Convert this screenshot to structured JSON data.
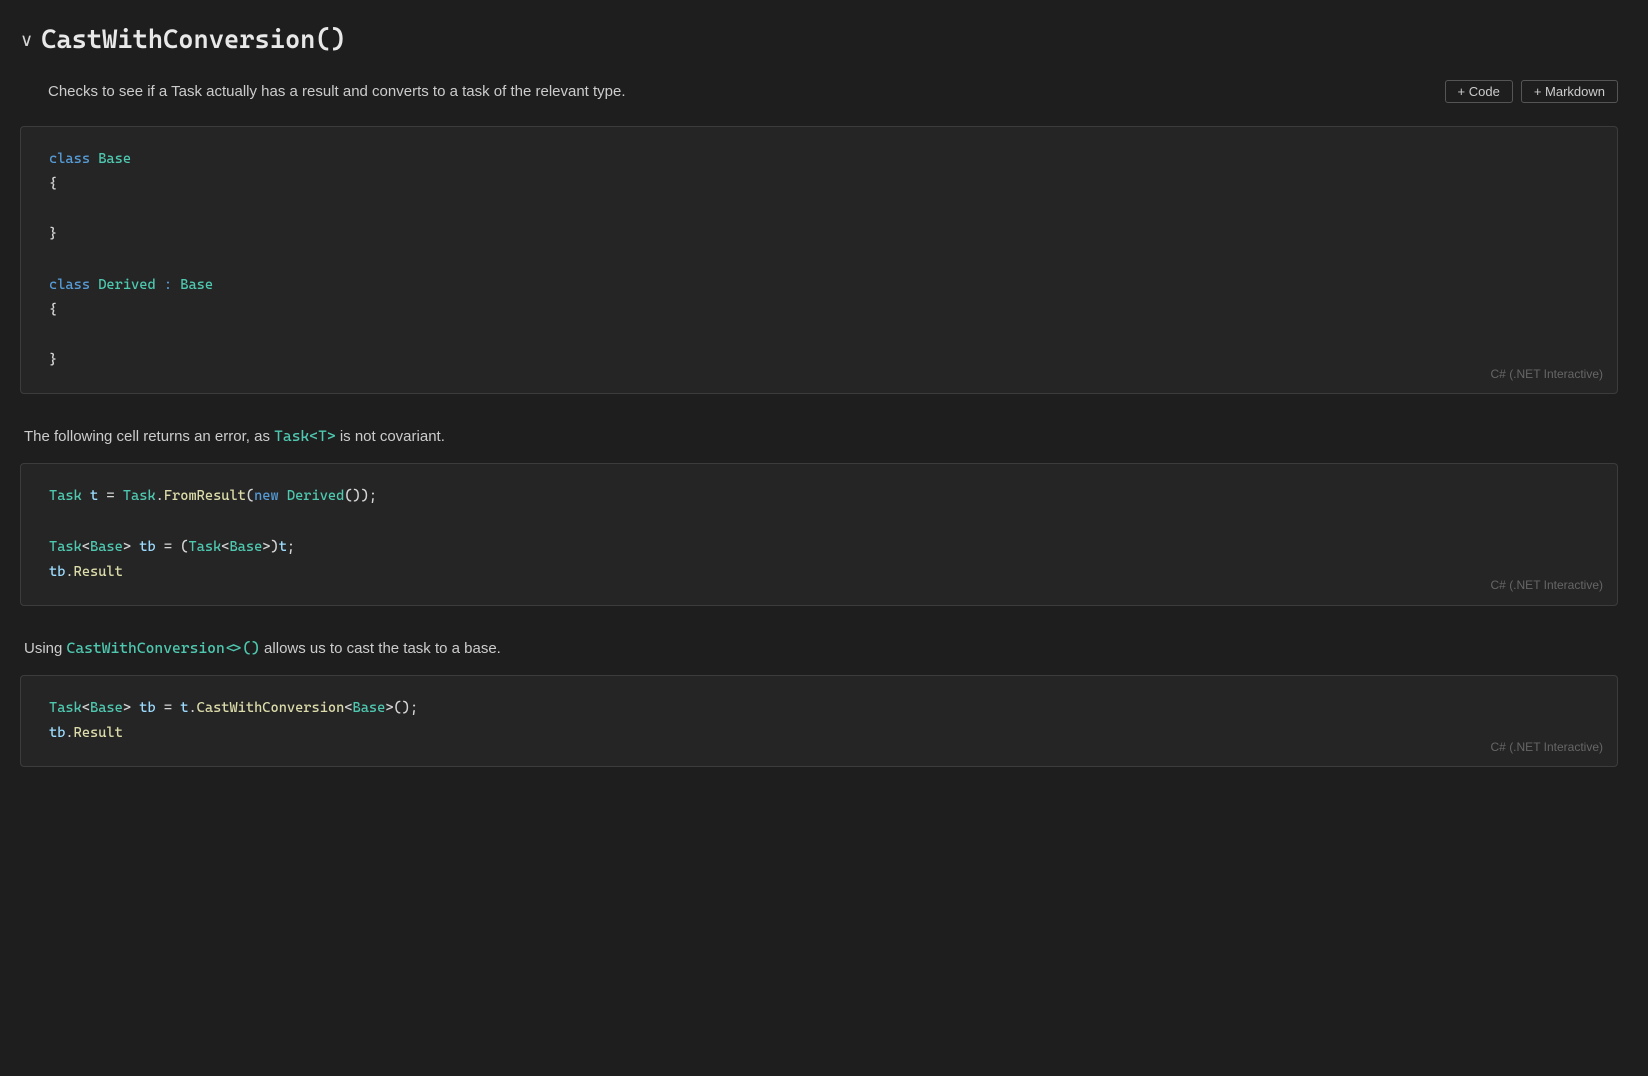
{
  "header": {
    "chevron": "∨",
    "title": "CastWithConversion()"
  },
  "prose1": {
    "text": "Checks to see if a Task actually has a result and converts to a task of the relevant type."
  },
  "toolbar": {
    "code_btn": "+ Code",
    "markdown_btn": "+ Markdown"
  },
  "code_block_1": {
    "lang": "C# (.NET Interactive)",
    "lines": [
      {
        "type": "code",
        "parts": [
          {
            "cls": "kw",
            "text": "class"
          },
          {
            "cls": "plain",
            "text": " "
          },
          {
            "cls": "cn",
            "text": "Base"
          }
        ]
      },
      {
        "type": "code",
        "parts": [
          {
            "cls": "punc",
            "text": "{"
          }
        ]
      },
      {
        "type": "empty"
      },
      {
        "type": "code",
        "parts": [
          {
            "cls": "punc",
            "text": "}"
          }
        ]
      },
      {
        "type": "empty"
      },
      {
        "type": "code",
        "parts": [
          {
            "cls": "kw",
            "text": "class"
          },
          {
            "cls": "plain",
            "text": " "
          },
          {
            "cls": "cn",
            "text": "Derived"
          },
          {
            "cls": "plain",
            "text": " "
          },
          {
            "cls": "inh",
            "text": ":"
          },
          {
            "cls": "plain",
            "text": " "
          },
          {
            "cls": "cn",
            "text": "Base"
          }
        ]
      },
      {
        "type": "code",
        "parts": [
          {
            "cls": "punc",
            "text": "{"
          }
        ]
      },
      {
        "type": "empty"
      },
      {
        "type": "code",
        "parts": [
          {
            "cls": "punc",
            "text": "}"
          }
        ]
      }
    ]
  },
  "prose2": {
    "before": "The following cell returns an error, as ",
    "highlight": "Task<T>",
    "after": " is not covariant."
  },
  "code_block_2": {
    "lang": "C# (.NET Interactive)",
    "lines": [
      {
        "type": "code",
        "parts": [
          {
            "cls": "cn",
            "text": "Task"
          },
          {
            "cls": "plain",
            "text": " "
          },
          {
            "cls": "var",
            "text": "t"
          },
          {
            "cls": "plain",
            "text": " = "
          },
          {
            "cls": "cn",
            "text": "Task"
          },
          {
            "cls": "plain",
            "text": "."
          },
          {
            "cls": "method",
            "text": "FromResult"
          },
          {
            "cls": "plain",
            "text": "("
          },
          {
            "cls": "kw-new",
            "text": "new"
          },
          {
            "cls": "plain",
            "text": " "
          },
          {
            "cls": "cn",
            "text": "Derived"
          },
          {
            "cls": "plain",
            "text": "());"
          }
        ]
      },
      {
        "type": "empty"
      },
      {
        "type": "code",
        "parts": [
          {
            "cls": "cn",
            "text": "Task"
          },
          {
            "cls": "plain",
            "text": "<"
          },
          {
            "cls": "cn",
            "text": "Base"
          },
          {
            "cls": "plain",
            "text": "> "
          },
          {
            "cls": "var",
            "text": "tb"
          },
          {
            "cls": "plain",
            "text": " = ("
          },
          {
            "cls": "cn",
            "text": "Task"
          },
          {
            "cls": "plain",
            "text": "<"
          },
          {
            "cls": "cn",
            "text": "Base"
          },
          {
            "cls": "plain",
            "text": ">)"
          },
          {
            "cls": "var",
            "text": "t"
          },
          {
            "cls": "plain",
            "text": ";"
          }
        ]
      },
      {
        "type": "code",
        "parts": [
          {
            "cls": "var",
            "text": "tb"
          },
          {
            "cls": "plain",
            "text": "."
          },
          {
            "cls": "method",
            "text": "Result"
          }
        ]
      }
    ]
  },
  "prose3": {
    "before": "Using ",
    "highlight": "CastWithConversion<>()",
    "after": " allows us to cast the task to a base."
  },
  "code_block_3": {
    "lang": "C# (.NET Interactive)",
    "lines": [
      {
        "type": "code",
        "parts": [
          {
            "cls": "cn",
            "text": "Task"
          },
          {
            "cls": "plain",
            "text": "<"
          },
          {
            "cls": "cn",
            "text": "Base"
          },
          {
            "cls": "plain",
            "text": "> "
          },
          {
            "cls": "var",
            "text": "tb"
          },
          {
            "cls": "plain",
            "text": " = "
          },
          {
            "cls": "var",
            "text": "t"
          },
          {
            "cls": "plain",
            "text": "."
          },
          {
            "cls": "method",
            "text": "CastWithConversion"
          },
          {
            "cls": "plain",
            "text": "<"
          },
          {
            "cls": "cn",
            "text": "Base"
          },
          {
            "cls": "plain",
            "text": ">();"
          }
        ]
      },
      {
        "type": "code",
        "parts": [
          {
            "cls": "var",
            "text": "tb"
          },
          {
            "cls": "plain",
            "text": "."
          },
          {
            "cls": "method",
            "text": "Result"
          }
        ]
      }
    ]
  }
}
